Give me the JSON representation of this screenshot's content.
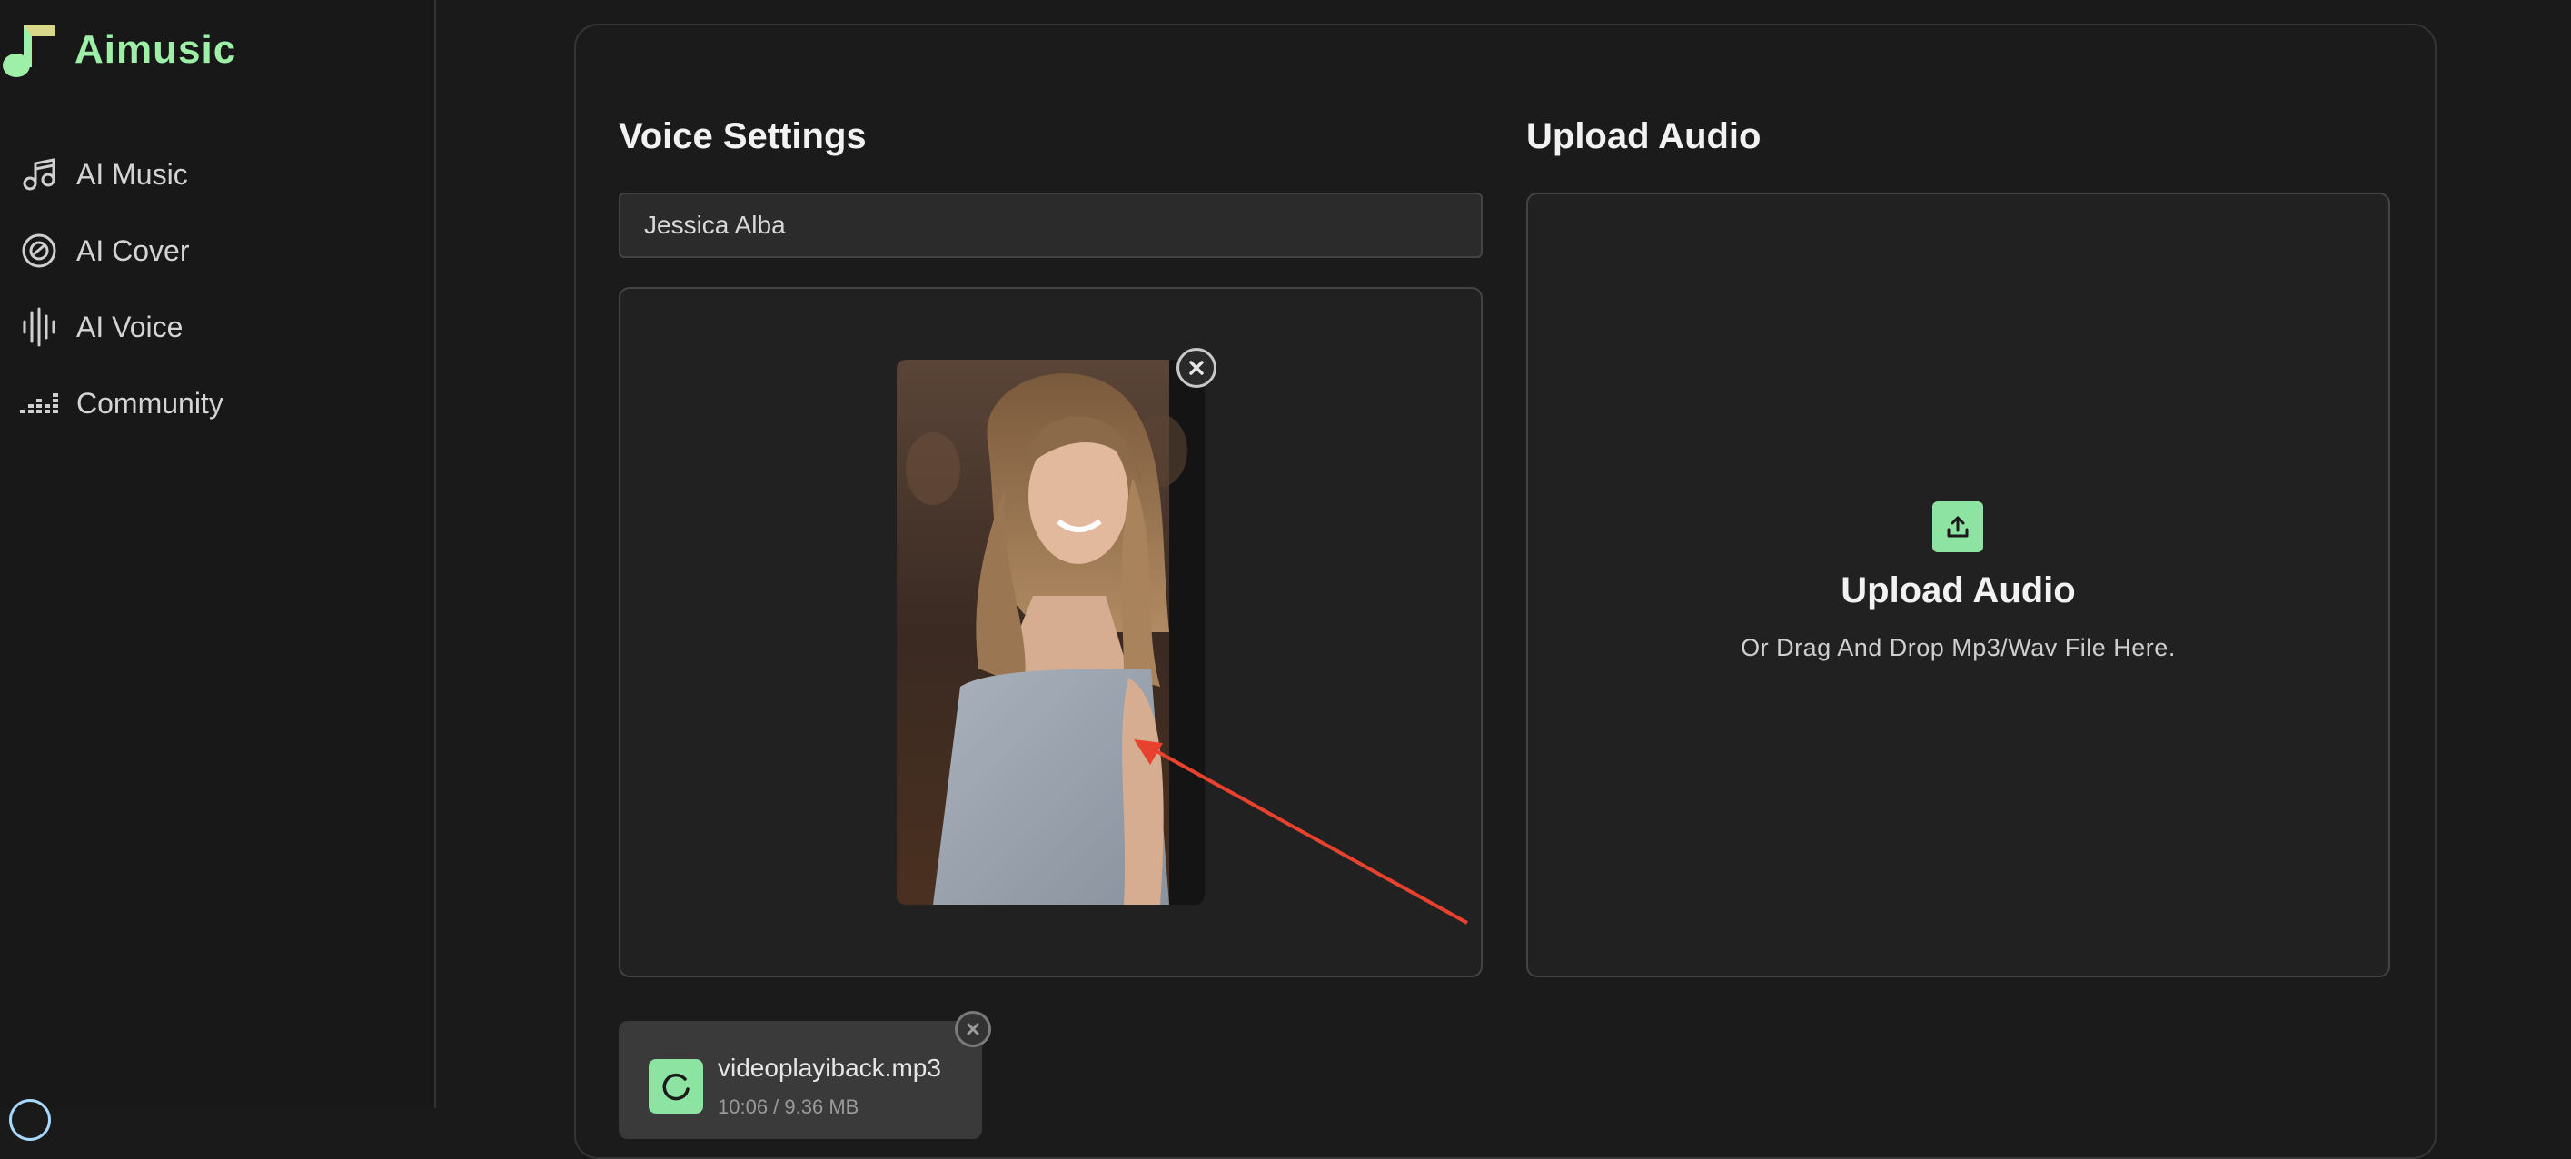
{
  "brand": {
    "name": "Aimusic",
    "logo_icon": "music-note-icon",
    "accent": "#9ef0a8"
  },
  "sidebar": {
    "items": [
      {
        "label": "AI Music",
        "icon": "music-note-icon"
      },
      {
        "label": "AI Cover",
        "icon": "vinyl-disc-icon"
      },
      {
        "label": "AI Voice",
        "icon": "waveform-icon"
      },
      {
        "label": "Community",
        "icon": "equalizer-icon"
      }
    ]
  },
  "voice_settings": {
    "title": "Voice Settings",
    "voice_value": "Jessica Alba",
    "image_icon": "portrait-photo",
    "remove_icon": "close-icon"
  },
  "upload_audio": {
    "section_title": "Upload Audio",
    "title": "Upload Audio",
    "hint": "Or Drag And Drop Mp3/Wav File Here.",
    "icon": "upload-icon"
  },
  "file": {
    "name": "videoplayiback.mp3",
    "meta": "10:06 / 9.36 MB",
    "icon": "spinner-icon",
    "remove_icon": "close-icon"
  },
  "colors": {
    "accent_green": "#8de3a1",
    "annotation_arrow": "#e8422e"
  }
}
